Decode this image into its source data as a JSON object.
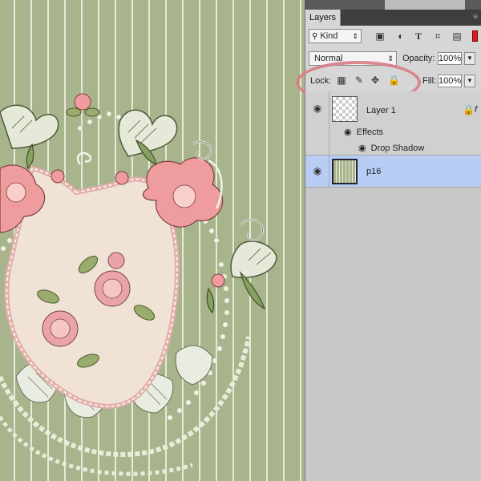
{
  "panel": {
    "tab_label": "Layers",
    "filter": {
      "kind_label": "Kind",
      "icons": [
        "image-filter-icon",
        "adjustment-filter-icon",
        "type-filter-icon",
        "shape-filter-icon",
        "smart-object-filter-icon"
      ]
    },
    "blend_mode": "Normal",
    "opacity_label": "Opacity:",
    "opacity_value": "100%",
    "lock_label": "Lock:",
    "lock_icons": [
      "lock-transparent-pixels-icon",
      "lock-image-pixels-icon",
      "lock-position-icon",
      "lock-all-icon"
    ],
    "fill_label": "Fill:",
    "fill_value": "100%",
    "layers": [
      {
        "name": "Layer 1",
        "effects_label": "Effects",
        "effect": "Drop Shadow",
        "selected": false
      },
      {
        "name": "p16",
        "selected": true
      }
    ]
  },
  "colors": {
    "canvas_bg": "#a8b48c",
    "stripe": "#e6ead8",
    "panel_bg": "#c8c8c8",
    "selected_row": "#b7cdf4",
    "highlight": "#d97c86"
  }
}
